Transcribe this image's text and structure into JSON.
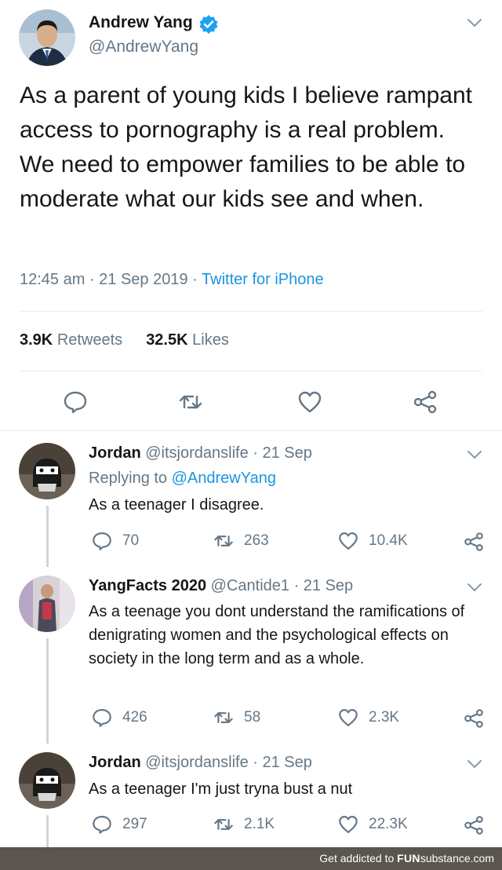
{
  "tweet": {
    "name": "Andrew Yang",
    "handle": "@AndrewYang",
    "text": "As a parent of young kids I believe rampant access to pornography is a real problem. We need to empower families to be able to moderate what our kids see and when.",
    "timestamp": "12:45 am · 21 Sep 2019 · ",
    "source": "Twitter for iPhone",
    "retweets_count": "3.9K",
    "retweets_label": "Retweets",
    "likes_count": "32.5K",
    "likes_label": "Likes"
  },
  "replies": [
    {
      "name": "Jordan",
      "meta": "@itsjordanslife · 21 Sep",
      "replying_prefix": "Replying to ",
      "replying_handle": "@AndrewYang",
      "text": "As a teenager I disagree.",
      "replies": "70",
      "retweets": "263",
      "likes": "10.4K"
    },
    {
      "name": "YangFacts 2020",
      "meta": "@Cantide1 · 21 Sep",
      "text": "As a teenage you dont understand the ramifications of denigrating women and the psychological effects on society in the long term and as a whole.",
      "replies": "426",
      "retweets": "58",
      "likes": "2.3K"
    },
    {
      "name": "Jordan",
      "meta": "@itsjordanslife · 21 Sep",
      "text": "As a teenager I'm just tryna bust a nut",
      "replies": "297",
      "retweets": "2.1K",
      "likes": "22.3K"
    }
  ],
  "footer": {
    "prefix": "Get addicted to ",
    "brand_a": "FUN",
    "brand_b": "substance",
    "brand_c": ".com"
  },
  "colors": {
    "link": "#1b95e0",
    "muted": "#657786",
    "text": "#14171a",
    "footer_bg": "#5b554f"
  },
  "icons": [
    "verified-badge-icon",
    "chevron-down-icon",
    "reply-icon",
    "retweet-icon",
    "like-icon",
    "share-icon"
  ]
}
